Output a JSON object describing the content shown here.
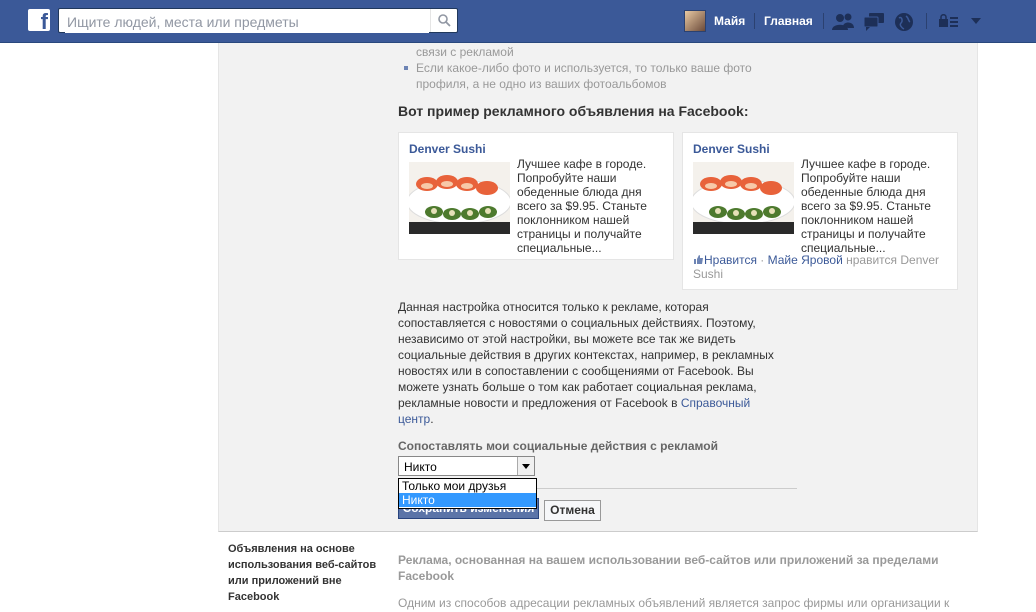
{
  "topbar": {
    "logo_letter": "f",
    "search_placeholder": "Ищите людей, места или предметы",
    "user_name": "Майя",
    "home_label": "Главная"
  },
  "panel": {
    "bullets": [
      "связи с рекламой",
      "Если какое-либо фото и используется, то только ваше фото профиля, а не одно из ваших фотоальбомов"
    ],
    "example_title": "Вот пример рекламного объявления на Facebook:",
    "ads": [
      {
        "title": "Denver Sushi",
        "text": "Лучшее кафе в городе. Попробуйте наши обеденные блюда дня всего за $9.95. Станьте поклонником нашей страницы и получайте специальные..."
      },
      {
        "title": "Denver Sushi",
        "text": "Лучшее кафе в городе. Попробуйте наши обеденные блюда дня всего за $9.95. Станьте поклонником нашей страницы и получайте специальные...",
        "like_label": "Нравится",
        "like_dot": " · ",
        "friend_name": "Майе Яровой",
        "like_suffix": " нравится Denver Sushi"
      }
    ],
    "description": "Данная настройка относится только к рекламе, которая сопоставляется с новостями о социальных действиях. Поэтому, независимо от этой настройки, вы можете все так же видеть социальные действия в других контекстах, например, в рекламных новостях или в сопоставлении с сообщениями от Facebook. Вы можете узнать больше о том как работает социальная реклама, рекламные новости и предложения от Facebook в ",
    "description_link": "Справочный центр",
    "description_end": ".",
    "field_label": "Сопоставлять мои социальные действия с рекламой",
    "select_value": "Никто",
    "dropdown_options": [
      "Только мои друзья",
      "Никто"
    ],
    "dropdown_selected_index": 1,
    "save_button": "Сохранить изменения",
    "cancel_button": "Отмена"
  },
  "section2": {
    "label": "Объявления на основе использования веб-сайтов или приложений вне Facebook",
    "title": "Реклама, основанная на вашем использовании веб-сайтов или приложений за пределами Facebook",
    "text": "Одним из способов адресации рекламных объявлений является запрос фирмы или организации к"
  },
  "colors": {
    "brand": "#3b5998",
    "topbar": "#3b5998",
    "link": "#3b5998",
    "dropdown_highlight": "#3399ff",
    "save_button": "#5b74a8"
  }
}
